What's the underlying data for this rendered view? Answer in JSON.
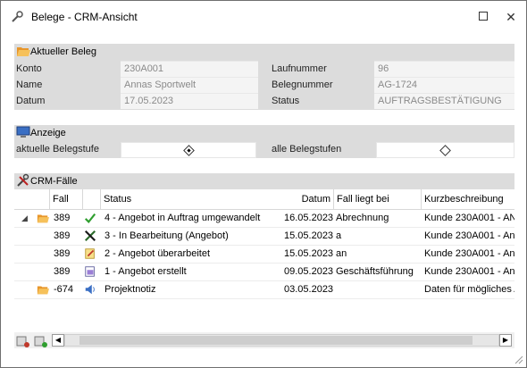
{
  "window": {
    "title": "Belege - CRM-Ansicht"
  },
  "aktueller_beleg": {
    "title": "Aktueller Beleg",
    "fields_left": [
      {
        "label": "Konto",
        "value": "230A001"
      },
      {
        "label": "Name",
        "value": "Annas Sportwelt"
      },
      {
        "label": "Datum",
        "value": "17.05.2023"
      }
    ],
    "fields_right": [
      {
        "label": "Laufnummer",
        "value": "96"
      },
      {
        "label": "Belegnummer",
        "value": "AG-1724"
      },
      {
        "label": "Status",
        "value": "AUFTRAGSBESTÄTIGUNG"
      }
    ]
  },
  "anzeige": {
    "title": "Anzeige",
    "option1_label": "aktuelle Belegstufe",
    "option2_label": "alle Belegstufen",
    "selected": "aktuelle Belegstufe"
  },
  "crm": {
    "title": "CRM-Fälle",
    "columns": [
      "Fall",
      "Status",
      "Datum",
      "Fall liegt bei",
      "Kurzbeschreibung"
    ],
    "rows": [
      {
        "fall": "389",
        "status": "4 - Angebot in Auftrag umgewandelt",
        "datum": "16.05.2023",
        "bei": "Abrechnung",
        "kurz": "Kunde 230A001 - AN",
        "icon": "check-icon",
        "expanded": true,
        "folder": true
      },
      {
        "fall": "389",
        "status": "3 - In Bearbeitung (Angebot)",
        "datum": "15.05.2023",
        "bei": "a",
        "kurz": "Kunde 230A001 - An",
        "icon": "tools-icon",
        "expanded": false,
        "folder": false
      },
      {
        "fall": "389",
        "status": "2 - Angebot überarbeitet",
        "datum": "15.05.2023",
        "bei": "an",
        "kurz": "Kunde 230A001 - An",
        "icon": "edit-document-icon",
        "expanded": false,
        "folder": false
      },
      {
        "fall": "389",
        "status": "1 - Angebot erstellt",
        "datum": "09.05.2023",
        "bei": "Geschäftsführung",
        "kurz": "Kunde 230A001 - An",
        "icon": "new-document-icon",
        "expanded": false,
        "folder": false
      },
      {
        "fall": "-674",
        "status": "Projektnotiz",
        "datum": "03.05.2023",
        "bei": "",
        "kurz": "Daten für mögliches A",
        "icon": "speaker-icon",
        "expanded": false,
        "folder": true
      }
    ]
  },
  "colors": {
    "section_bg": "#dcdcdc",
    "value_text": "#8a8a8a",
    "check": "#2e9e2e",
    "folder": "#f0a030"
  }
}
